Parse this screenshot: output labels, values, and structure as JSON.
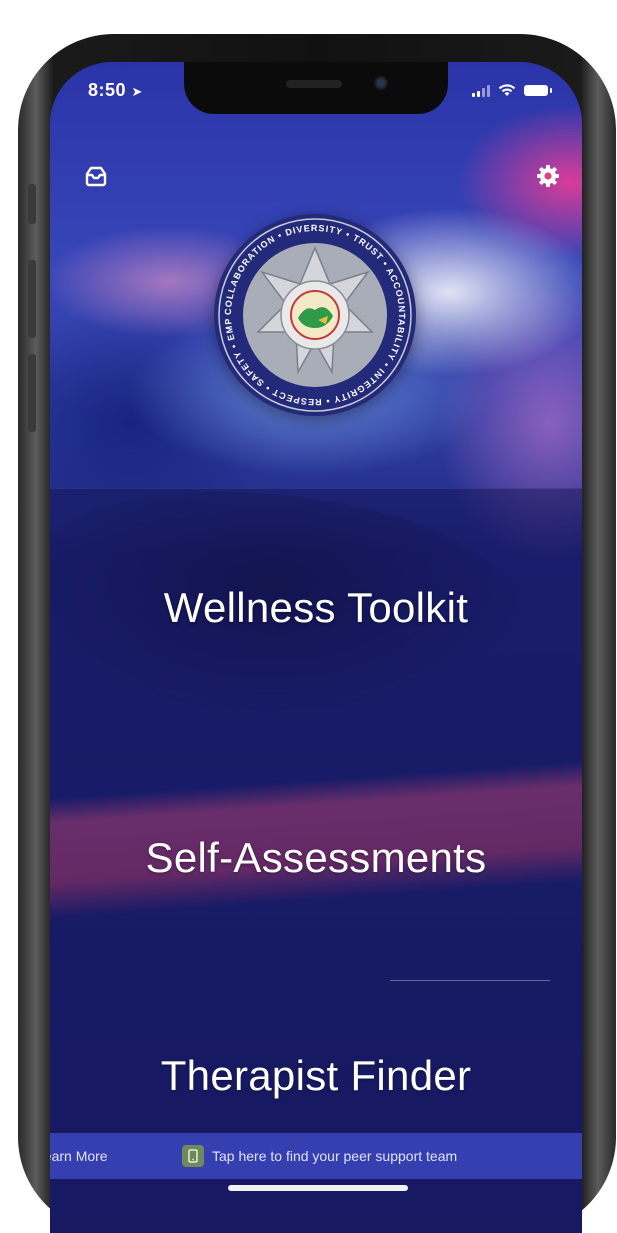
{
  "status_bar": {
    "time": "8:50"
  },
  "header": {
    "inbox_icon": "inbox-icon",
    "settings_icon": "gear-icon"
  },
  "badge": {
    "ring_text": "COLLABORATION • DIVERSITY • TRUST • ACCOUNTABILITY • INTEGRITY • RESPECT • SAFETY • EMPATHY •",
    "colors": {
      "ring": "#232a7a",
      "star": "#b9bcc4",
      "center": "#2f9a4a"
    }
  },
  "menu": {
    "items": [
      {
        "label": "Wellness Toolkit"
      },
      {
        "label": "Self-Assessments"
      },
      {
        "label": "Therapist Finder"
      }
    ]
  },
  "bottom_bar": {
    "learn_more": "Learn More",
    "peer_support": "Tap here to find your peer support team"
  },
  "colors": {
    "background": "#1e1f6e",
    "accent_pink": "#eb3c96",
    "bottom_bar": "#3c46be"
  }
}
